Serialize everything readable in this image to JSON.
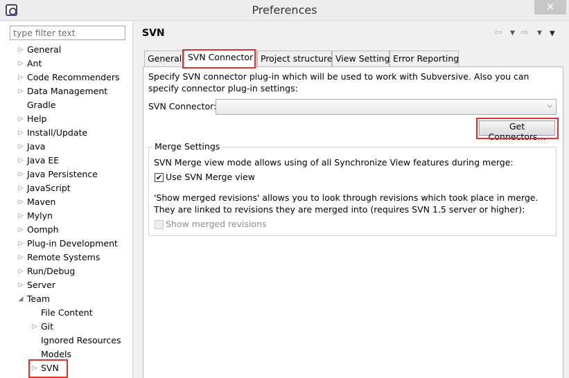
{
  "window": {
    "title": "Preferences",
    "close_label": "✕"
  },
  "filter": {
    "placeholder": "type filter text",
    "value": ""
  },
  "tree": [
    {
      "label": "General",
      "expandable": true,
      "expanded": false,
      "level": 0
    },
    {
      "label": "Ant",
      "expandable": true,
      "expanded": false,
      "level": 0
    },
    {
      "label": "Code Recommenders",
      "expandable": true,
      "expanded": false,
      "level": 0
    },
    {
      "label": "Data Management",
      "expandable": true,
      "expanded": false,
      "level": 0
    },
    {
      "label": "Gradle",
      "expandable": false,
      "expanded": false,
      "level": 0
    },
    {
      "label": "Help",
      "expandable": true,
      "expanded": false,
      "level": 0
    },
    {
      "label": "Install/Update",
      "expandable": true,
      "expanded": false,
      "level": 0
    },
    {
      "label": "Java",
      "expandable": true,
      "expanded": false,
      "level": 0
    },
    {
      "label": "Java EE",
      "expandable": true,
      "expanded": false,
      "level": 0
    },
    {
      "label": "Java Persistence",
      "expandable": true,
      "expanded": false,
      "level": 0
    },
    {
      "label": "JavaScript",
      "expandable": true,
      "expanded": false,
      "level": 0
    },
    {
      "label": "Maven",
      "expandable": true,
      "expanded": false,
      "level": 0
    },
    {
      "label": "Mylyn",
      "expandable": true,
      "expanded": false,
      "level": 0
    },
    {
      "label": "Oomph",
      "expandable": true,
      "expanded": false,
      "level": 0
    },
    {
      "label": "Plug-in Development",
      "expandable": true,
      "expanded": false,
      "level": 0
    },
    {
      "label": "Remote Systems",
      "expandable": true,
      "expanded": false,
      "level": 0
    },
    {
      "label": "Run/Debug",
      "expandable": true,
      "expanded": false,
      "level": 0
    },
    {
      "label": "Server",
      "expandable": true,
      "expanded": false,
      "level": 0
    },
    {
      "label": "Team",
      "expandable": true,
      "expanded": true,
      "level": 0
    },
    {
      "label": "File Content",
      "expandable": false,
      "expanded": false,
      "level": 1
    },
    {
      "label": "Git",
      "expandable": true,
      "expanded": false,
      "level": 1
    },
    {
      "label": "Ignored Resources",
      "expandable": false,
      "expanded": false,
      "level": 1
    },
    {
      "label": "Models",
      "expandable": false,
      "expanded": false,
      "level": 1
    },
    {
      "label": "SVN",
      "expandable": true,
      "expanded": false,
      "level": 1
    }
  ],
  "page": {
    "title": "SVN"
  },
  "tabs": [
    "General",
    "SVN Connector",
    "Project structure",
    "View Settings",
    "Error Reporting"
  ],
  "active_tab": "SVN Connector",
  "connector": {
    "description": "Specify SVN connector plug-in which will be used to work with Subversive. Also you can specify connector plug-in settings:",
    "label": "SVN Connector:",
    "selected_value": "",
    "get_button": "Get Connectors..."
  },
  "merge": {
    "group_title": "Merge Settings",
    "description": "SVN Merge view mode allows using of all Synchronize View features during merge:",
    "use_merge_view": {
      "label": "Use SVN Merge view",
      "checked": true,
      "enabled": true
    },
    "show_description": "'Show merged revisions' allows you to look through revisions which took place in merge. They are linked to revisions they are merged into (requires SVN 1.5 server or higher):",
    "show_merged_revisions": {
      "label": "Show merged revisions",
      "checked": false,
      "enabled": false
    }
  },
  "annotations": {
    "highlight_color": "#e0302a"
  }
}
